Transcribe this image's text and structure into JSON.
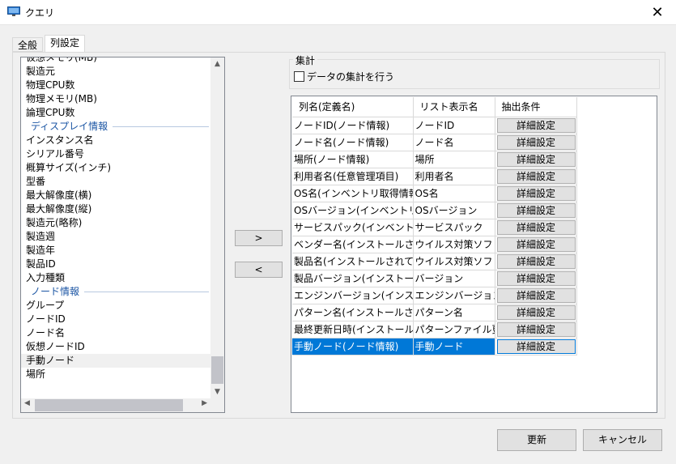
{
  "window": {
    "title": "クエリ",
    "icon": "monitor-icon",
    "close_label": "✕"
  },
  "tabs": [
    {
      "label": "全般"
    },
    {
      "label": "列設定"
    }
  ],
  "left_list": {
    "items": [
      {
        "kind": "item",
        "label": "仮想メモリ(MB)"
      },
      {
        "kind": "item",
        "label": "製造元"
      },
      {
        "kind": "item",
        "label": "物理CPU数"
      },
      {
        "kind": "item",
        "label": "物理メモリ(MB)"
      },
      {
        "kind": "item",
        "label": "論理CPU数"
      },
      {
        "kind": "group",
        "label": "ディスプレイ情報"
      },
      {
        "kind": "item",
        "label": "インスタンス名"
      },
      {
        "kind": "item",
        "label": "シリアル番号"
      },
      {
        "kind": "item",
        "label": "概算サイズ(インチ)"
      },
      {
        "kind": "item",
        "label": "型番"
      },
      {
        "kind": "item",
        "label": "最大解像度(横)"
      },
      {
        "kind": "item",
        "label": "最大解像度(縦)"
      },
      {
        "kind": "item",
        "label": "製造元(略称)"
      },
      {
        "kind": "item",
        "label": "製造週"
      },
      {
        "kind": "item",
        "label": "製造年"
      },
      {
        "kind": "item",
        "label": "製品ID"
      },
      {
        "kind": "item",
        "label": "入力種類"
      },
      {
        "kind": "group",
        "label": "ノード情報"
      },
      {
        "kind": "item",
        "label": "グループ"
      },
      {
        "kind": "item",
        "label": "ノードID"
      },
      {
        "kind": "item",
        "label": "ノード名"
      },
      {
        "kind": "item",
        "label": "仮想ノードID"
      },
      {
        "kind": "item",
        "label": "手動ノード",
        "selected": true
      },
      {
        "kind": "item",
        "label": "場所"
      }
    ]
  },
  "move_buttons": {
    "add": ">",
    "remove": "<"
  },
  "aggregate": {
    "group_label": "集計",
    "checkbox_label": "データの集計を行う",
    "checked": false
  },
  "grid": {
    "headers": [
      "列名(定義名)",
      "リスト表示名",
      "抽出条件"
    ],
    "button_label": "詳細設定",
    "rows": [
      {
        "col_name": "ノードID(ノード情報)",
        "display": "ノードID"
      },
      {
        "col_name": "ノード名(ノード情報)",
        "display": "ノード名"
      },
      {
        "col_name": "場所(ノード情報)",
        "display": "場所"
      },
      {
        "col_name": "利用者名(任意管理項目)",
        "display": "利用者名"
      },
      {
        "col_name": "OS名(インベントリ取得情報)",
        "display": "OS名"
      },
      {
        "col_name": "OSバージョン(インベントリ取…",
        "display": "OSバージョン"
      },
      {
        "col_name": "サービスパック(インベントリ取…",
        "display": "サービスパック"
      },
      {
        "col_name": "ベンダー名(インストールされて…",
        "display": "ウイルス対策ソフト…"
      },
      {
        "col_name": "製品名(インストールされてい…",
        "display": "ウイルス対策ソフト…"
      },
      {
        "col_name": "製品バージョン(インストールさ…",
        "display": "バージョン"
      },
      {
        "col_name": "エンジンバージョン(インストー…",
        "display": "エンジンバージョン"
      },
      {
        "col_name": "パターン名(インストールされて…",
        "display": "パターン名"
      },
      {
        "col_name": "最終更新日時(インストール…",
        "display": "パターンファイル更…"
      },
      {
        "col_name": "手動ノード(ノード情報)",
        "display": "手動ノード",
        "selected": true
      }
    ]
  },
  "footer": {
    "update_label": "更新",
    "cancel_label": "キャンセル"
  },
  "colors": {
    "selection": "#0078d7",
    "group_header": "#1c56a4"
  }
}
